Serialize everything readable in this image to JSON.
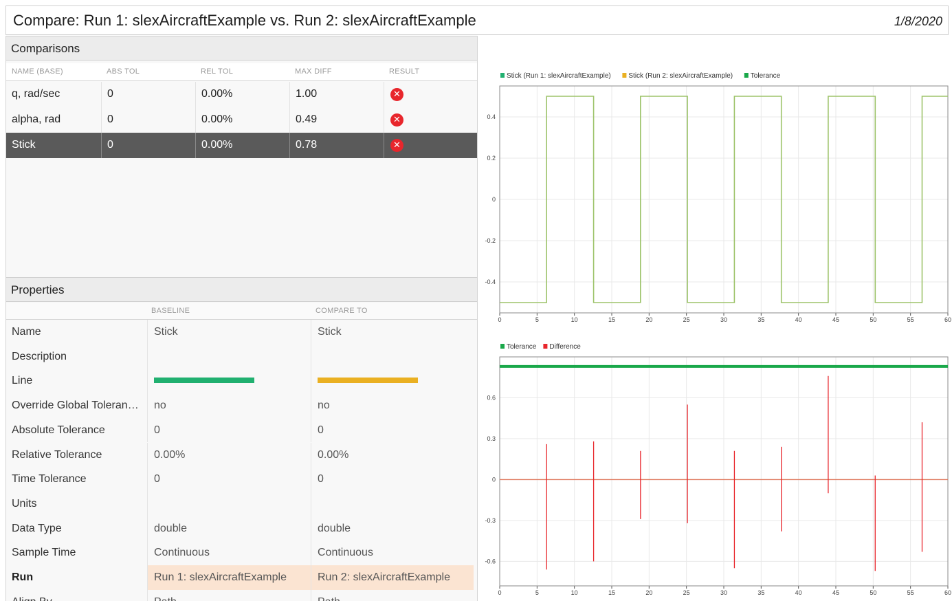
{
  "window": {
    "title": "Compare: Run 1: slexAircraftExample vs. Run 2: slexAircraftExample",
    "date": "1/8/2020"
  },
  "comparisons": {
    "header": "Comparisons",
    "columns": [
      "NAME (BASE)",
      "ABS TOL",
      "REL TOL",
      "MAX DIFF",
      "RESULT"
    ],
    "rows": [
      {
        "name": "q, rad/sec",
        "abs_tol": "0",
        "rel_tol": "0.00%",
        "max_diff": "1.00",
        "result": "fail",
        "selected": false
      },
      {
        "name": "alpha, rad",
        "abs_tol": "0",
        "rel_tol": "0.00%",
        "max_diff": "0.49",
        "result": "fail",
        "selected": false
      },
      {
        "name": "Stick",
        "abs_tol": "0",
        "rel_tol": "0.00%",
        "max_diff": "0.78",
        "result": "fail",
        "selected": true
      }
    ]
  },
  "properties": {
    "header": "Properties",
    "columns": [
      "",
      "BASELINE",
      "COMPARE TO"
    ],
    "rows": [
      {
        "key": "Name",
        "baseline": "Stick",
        "compare": "Stick"
      },
      {
        "key": "Description",
        "baseline": "",
        "compare": ""
      },
      {
        "key": "Line",
        "baseline": "",
        "compare": "",
        "line_colors": [
          "#21b070",
          "#eab022"
        ]
      },
      {
        "key": "Override Global Tolerance",
        "baseline": "no",
        "compare": "no"
      },
      {
        "key": "Absolute Tolerance",
        "baseline": "0",
        "compare": "0"
      },
      {
        "key": "Relative Tolerance",
        "baseline": "0.00%",
        "compare": "0.00%"
      },
      {
        "key": "Time Tolerance",
        "baseline": "0",
        "compare": "0"
      },
      {
        "key": "Units",
        "baseline": "",
        "compare": ""
      },
      {
        "key": "Data Type",
        "baseline": "double",
        "compare": "double"
      },
      {
        "key": "Sample Time",
        "baseline": "Continuous",
        "compare": "Continuous"
      },
      {
        "key": "Run",
        "baseline": "Run 1: slexAircraftExample",
        "compare": "Run 2: slexAircraftExample",
        "bold": true,
        "highlight": true
      },
      {
        "key": "Align By",
        "baseline": "Path",
        "compare": "Path"
      }
    ]
  },
  "colors": {
    "run1": "#21b070",
    "run2": "#eab022",
    "tolerance": "#1aa84a",
    "difference": "#e8262c",
    "signal": "#9dc36a",
    "selected_row": "#5a5a5a",
    "highlight": "#fbe4d2"
  },
  "chart_data": [
    {
      "type": "line",
      "legend": [
        "Stick (Run 1: slexAircraftExample)",
        "Stick (Run 2: slexAircraftExample)",
        "Tolerance"
      ],
      "legend_position": "top-left",
      "xlim": [
        0,
        60
      ],
      "ylim": [
        -0.55,
        0.55
      ],
      "xticks": [
        0,
        5,
        10,
        15,
        20,
        25,
        30,
        35,
        40,
        45,
        50,
        55,
        60
      ],
      "yticks": [
        0.4,
        0.2,
        0,
        -0.2,
        -0.4
      ],
      "ytick_labels": [
        "0.4",
        "0.2",
        "0",
        "-0.2",
        "-0.4"
      ],
      "grid": true,
      "series": [
        {
          "name": "Stick",
          "x": [
            0,
            6.28,
            6.28,
            12.57,
            12.57,
            18.85,
            18.85,
            25.13,
            25.13,
            31.42,
            31.42,
            37.7,
            37.7,
            43.98,
            43.98,
            50.27,
            50.27,
            56.55,
            56.55,
            60
          ],
          "y": [
            -0.5,
            -0.5,
            0.5,
            0.5,
            -0.5,
            -0.5,
            0.5,
            0.5,
            -0.5,
            -0.5,
            0.5,
            0.5,
            -0.5,
            -0.5,
            0.5,
            0.5,
            -0.5,
            -0.5,
            0.5,
            0.5
          ]
        }
      ]
    },
    {
      "type": "line",
      "legend": [
        "Tolerance",
        "Difference"
      ],
      "legend_position": "top-left",
      "xlim": [
        0,
        60
      ],
      "ylim": [
        -0.78,
        0.9
      ],
      "xticks": [
        0,
        5,
        10,
        15,
        20,
        25,
        30,
        35,
        40,
        45,
        50,
        55,
        60
      ],
      "yticks": [
        0.6,
        0.3,
        0,
        -0.3,
        -0.6
      ],
      "ytick_labels": [
        "0.6",
        "0.3",
        "0",
        "-0.3",
        "-0.6"
      ],
      "grid": true,
      "tolerance_y": 0.83,
      "spikes": [
        {
          "x": 6.28,
          "min": -0.66,
          "max": 0.26
        },
        {
          "x": 12.57,
          "min": -0.6,
          "max": 0.28
        },
        {
          "x": 18.85,
          "min": -0.29,
          "max": 0.21
        },
        {
          "x": 25.13,
          "min": -0.32,
          "max": 0.55
        },
        {
          "x": 31.42,
          "min": -0.65,
          "max": 0.21
        },
        {
          "x": 37.7,
          "min": -0.38,
          "max": 0.24
        },
        {
          "x": 43.98,
          "min": -0.1,
          "max": 0.76
        },
        {
          "x": 50.27,
          "min": -0.67,
          "max": 0.03
        },
        {
          "x": 56.55,
          "min": -0.53,
          "max": 0.42
        }
      ]
    }
  ]
}
